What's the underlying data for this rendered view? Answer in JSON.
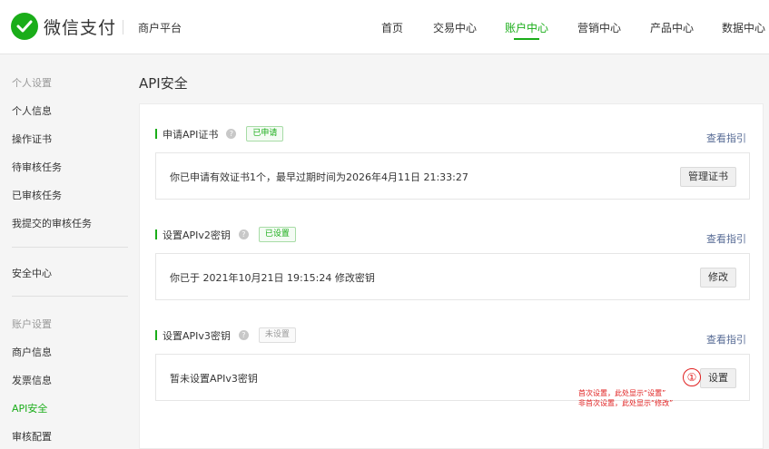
{
  "header": {
    "logo_text": "微信支付",
    "platform": "商户平台",
    "nav": [
      "首页",
      "交易中心",
      "账户中心",
      "营销中心",
      "产品中心",
      "数据中心"
    ],
    "active_nav": "账户中心"
  },
  "sidebar": {
    "group1": "个人设置",
    "items1": [
      "个人信息",
      "操作证书",
      "待审核任务",
      "已审核任务",
      "我提交的审核任务"
    ],
    "security": "安全中心",
    "group2": "账户设置",
    "items2": [
      "商户信息",
      "发票信息",
      "API安全",
      "审核配置"
    ],
    "active_item": "API安全"
  },
  "main": {
    "title": "API安全",
    "sections": [
      {
        "title": "申请API证书",
        "tag": "已申请",
        "guide": "查看指引",
        "text": "你已申请有效证书1个，最早过期时间为2026年4月11日 21:33:27",
        "button": "管理证书"
      },
      {
        "title": "设置APIv2密钥",
        "tag": "已设置",
        "guide": "查看指引",
        "text": "你已于 2021年10月21日 19:15:24 修改密钥",
        "button": "修改"
      },
      {
        "title": "设置APIv3密钥",
        "tag": "未设置",
        "guide": "查看指引",
        "text": "暂未设置APIv3密钥",
        "button": "设置"
      }
    ],
    "annotation": {
      "marker": "①",
      "line1": "首次设置，此处显示“设置”",
      "line2": "非首次设置，此处显示“修改”"
    }
  },
  "colors": {
    "brand_green": "#1aad19",
    "link_blue": "#576b95",
    "annotation_red": "#e02020"
  },
  "icons": {
    "logo": "wechat-pay-logo-icon",
    "help": "help-circle-icon"
  }
}
